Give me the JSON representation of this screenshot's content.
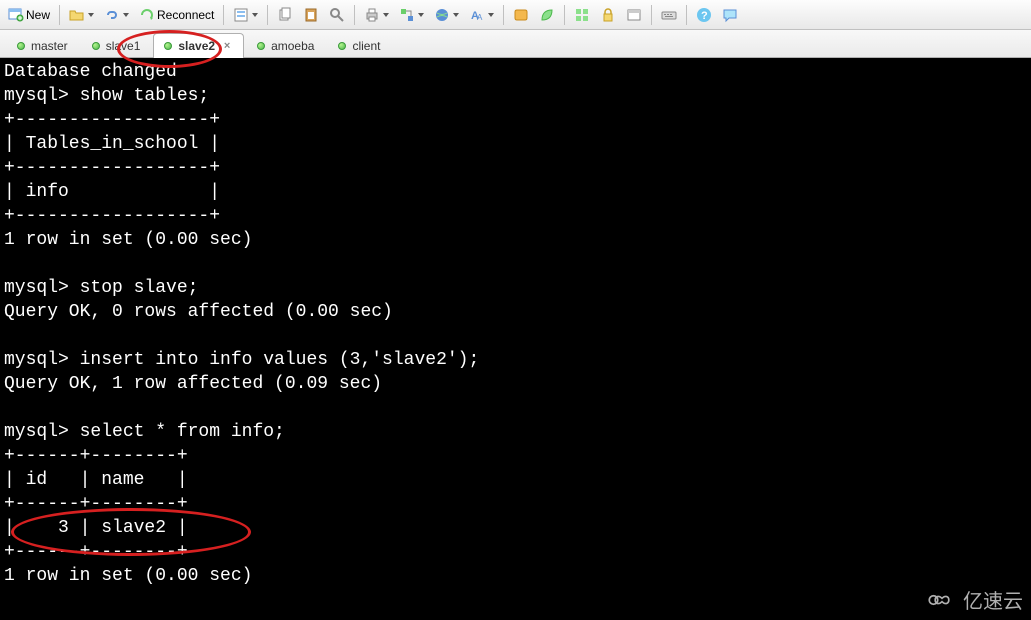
{
  "toolbar": {
    "new_label": "New",
    "reconnect_label": "Reconnect"
  },
  "tabs": [
    {
      "label": "master",
      "active": false
    },
    {
      "label": "slave1",
      "active": false
    },
    {
      "label": "slave2",
      "active": true
    },
    {
      "label": "amoeba",
      "active": false
    },
    {
      "label": "client",
      "active": false
    }
  ],
  "terminal": {
    "lines": [
      "Database changed",
      "mysql> show tables;",
      "+------------------+",
      "| Tables_in_school |",
      "+------------------+",
      "| info             |",
      "+------------------+",
      "1 row in set (0.00 sec)",
      "",
      "mysql> stop slave;",
      "Query OK, 0 rows affected (0.00 sec)",
      "",
      "mysql> insert into info values (3,'slave2');",
      "Query OK, 1 row affected (0.09 sec)",
      "",
      "mysql> select * from info;",
      "+------+--------+",
      "| id   | name   |",
      "+------+--------+",
      "|    3 | slave2 |",
      "+------+--------+",
      "1 row in set (0.00 sec)"
    ]
  },
  "watermark": {
    "text": "亿速云"
  },
  "annotations": {
    "tab_circle": {
      "target": "slave2-tab"
    },
    "row_circle": {
      "target": "result-row id=3 slave2"
    }
  }
}
